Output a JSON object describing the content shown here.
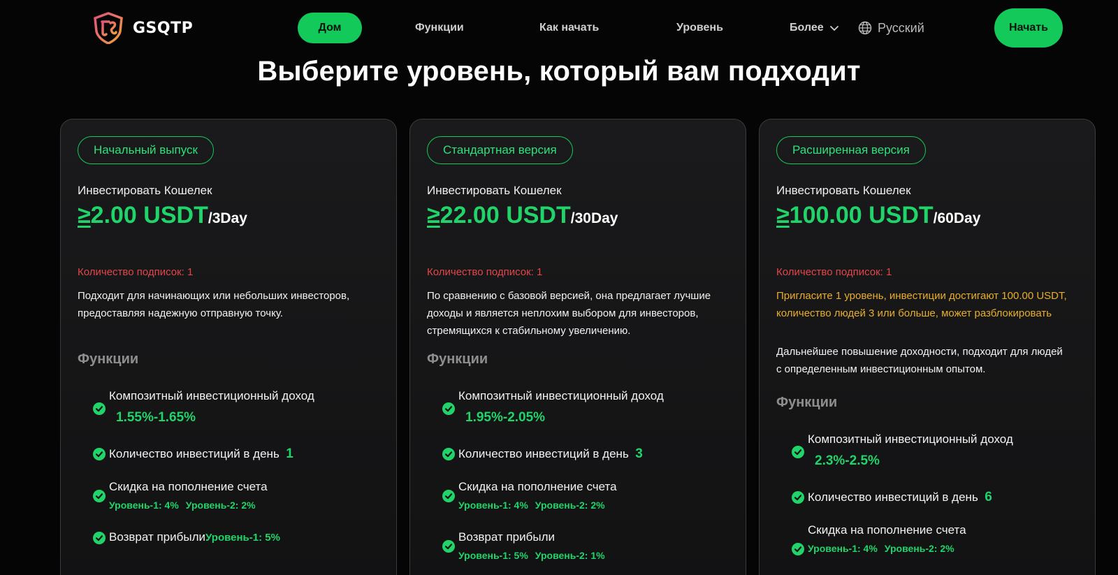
{
  "brand": {
    "name": "GSQTP",
    "accent": "#12c95a"
  },
  "nav": {
    "home": "Дом",
    "functions": "Функции",
    "how_to_start": "Как начать",
    "level": "Уровень",
    "more": "Более",
    "language": "Русский",
    "start": "Начать"
  },
  "page_title": "Выберите уровень, который вам подходит",
  "cards": [
    {
      "badge": "Начальный выпуск",
      "invest_label": "Инвестировать Кошелек",
      "ge": "≥",
      "amount": "2.00 USDT",
      "period": "/3Day",
      "subscriptions": "Количество подписок: 1",
      "unlock": "",
      "description": "Подходит для начинающих или небольших инвесторов, предоставляя надежную отправную точку.",
      "features_title": "Функции",
      "features": {
        "composite_label": "Композитный инвестиционный доход",
        "composite_value": "1.55%-1.65%",
        "per_day_label": "Количество инвестиций в день",
        "per_day_value": "1",
        "discount_label": "Скидка на пополнение счета",
        "discount_l1": "Уровень-1: 4%",
        "discount_l2": "Уровень-2: 2%",
        "rebate_label": "Возврат прибыли",
        "rebate_l1": "Уровень-1: 5%"
      }
    },
    {
      "badge": "Стандартная версия",
      "invest_label": "Инвестировать Кошелек",
      "ge": "≥",
      "amount": "22.00 USDT",
      "period": "/30Day",
      "subscriptions": "Количество подписок: 1",
      "unlock": "",
      "description": "По сравнению с базовой версией, она предлагает лучшие доходы и является неплохим выбором для инвесторов, стремящихся к стабильному увеличению.",
      "features_title": "Функции",
      "features": {
        "composite_label": "Композитный инвестиционный доход",
        "composite_value": "1.95%-2.05%",
        "per_day_label": "Количество инвестиций в день",
        "per_day_value": "3",
        "discount_label": "Скидка на пополнение счета",
        "discount_l1": "Уровень-1: 4%",
        "discount_l2": "Уровень-2: 2%",
        "rebate_label": "Возврат прибыли",
        "rebate_l1": "Уровень-1: 5%",
        "rebate_l2": "Уровень-2: 1%"
      }
    },
    {
      "badge": "Расширенная версия",
      "invest_label": "Инвестировать Кошелек",
      "ge": "≥",
      "amount": "100.00 USDT",
      "period": "/60Day",
      "subscriptions": "Количество подписок: 1",
      "unlock": "Пригласите 1 уровень, инвестиции достигают 100.00 USDT, количество людей 3 или больше, может разблокировать",
      "description": "Дальнейшее повышение доходности, подходит для людей с определенным инвестиционным опытом.",
      "features_title": "Функции",
      "features": {
        "composite_label": "Композитный инвестиционный доход",
        "composite_value": "2.3%-2.5%",
        "per_day_label": "Количество инвестиций в день",
        "per_day_value": "6",
        "discount_label": "Скидка на пополнение счета",
        "discount_l1": "Уровень-1: 4%",
        "discount_l2": "Уровень-2: 2%"
      }
    }
  ]
}
